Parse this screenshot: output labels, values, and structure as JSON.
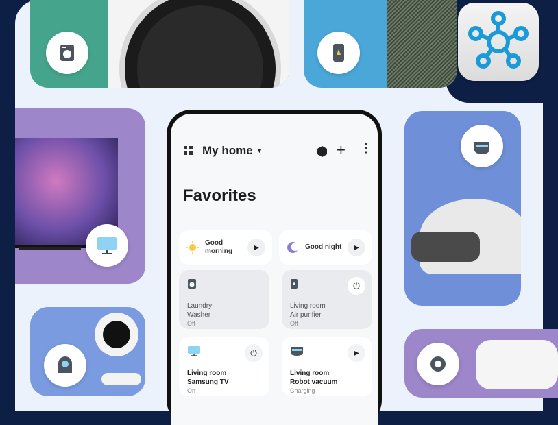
{
  "app": {
    "home_selector": "My home",
    "favorites_title": "Favorites"
  },
  "scenes": [
    {
      "label_line1": "Good",
      "label_line2": "morning",
      "icon": "sun-icon"
    },
    {
      "label_line1": "Good night",
      "label_line2": "",
      "icon": "moon-icon"
    }
  ],
  "devices": [
    {
      "room": "Laundry",
      "name": "Washer",
      "status": "Off",
      "icon": "washer-icon",
      "control": "none"
    },
    {
      "room": "Living room",
      "name": "Air purifier",
      "status": "Off",
      "icon": "air-purifier-icon",
      "control": "power"
    },
    {
      "room": "Living room",
      "name": "Samsung TV",
      "status": "On",
      "icon": "tv-icon",
      "control": "power"
    },
    {
      "room": "Living room",
      "name": "Robot vacuum",
      "status": "Charging",
      "icon": "robot-vacuum-icon",
      "control": "play"
    }
  ],
  "colors": {
    "background_navy": "#0d1f45",
    "panel": "#ebf2fb",
    "teal": "#45a58c",
    "sky_blue": "#4aa7d8",
    "lavender": "#9d86c9",
    "periwinkle": "#6f8fd8",
    "smartthings_blue": "#1a9ad9"
  }
}
